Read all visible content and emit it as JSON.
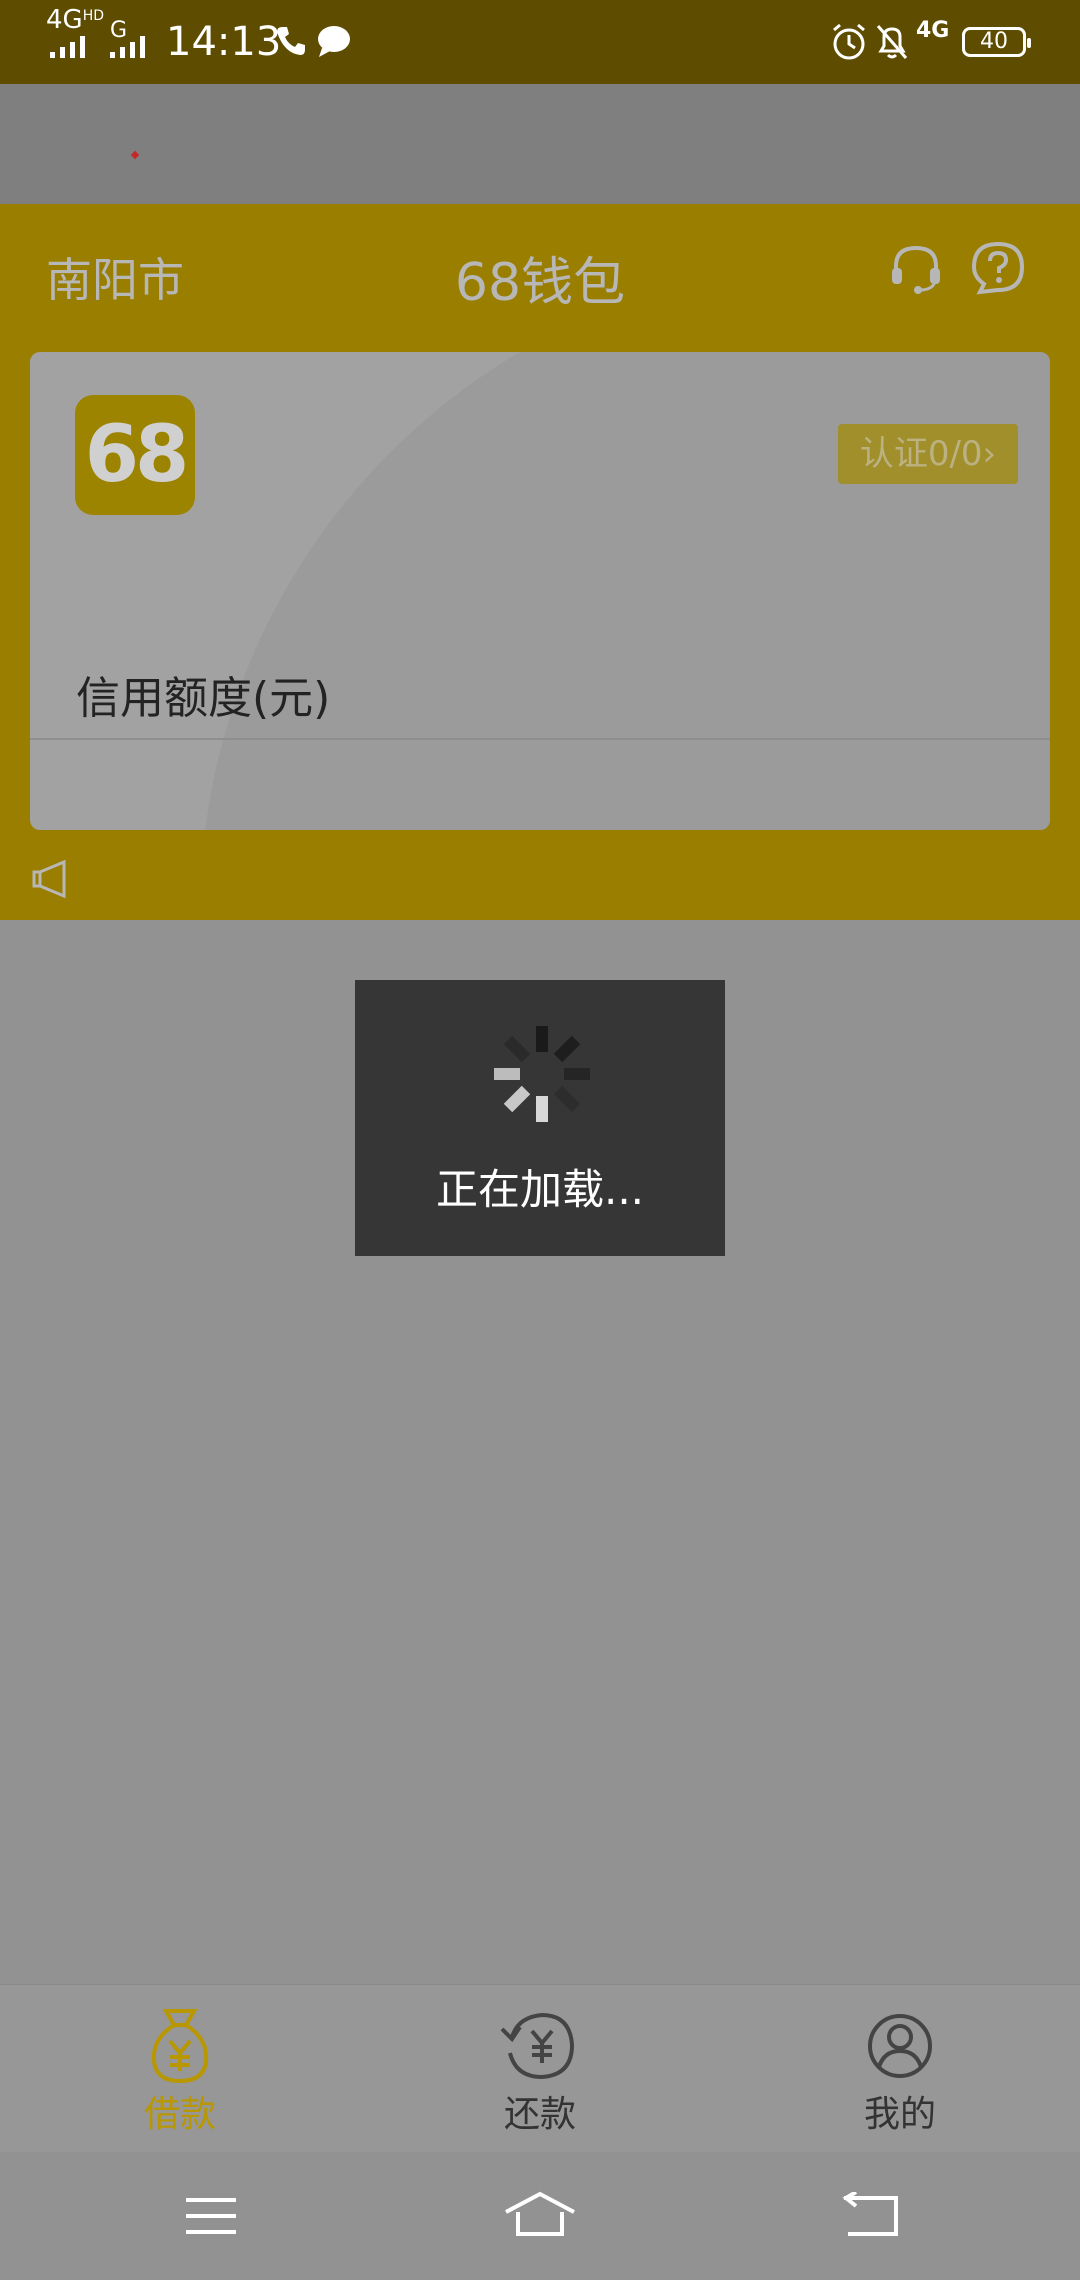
{
  "status_bar": {
    "network1": "4G",
    "network1_sup": "HD",
    "network2": "G",
    "time": "14:13",
    "network3": "4G",
    "battery": "40"
  },
  "header": {
    "city": "南阳市",
    "title": "68钱包"
  },
  "card": {
    "logo_text": "68",
    "cert_badge": "认证0/0",
    "credit_label": "信用额度(元)"
  },
  "loading": {
    "text": "正在加载..."
  },
  "bottom_nav": {
    "items": [
      {
        "label": "借款",
        "icon": "money-bag-icon",
        "active": true
      },
      {
        "label": "还款",
        "icon": "repay-icon",
        "active": false
      },
      {
        "label": "我的",
        "icon": "profile-icon",
        "active": false
      }
    ]
  },
  "colors": {
    "accent": "#9a7e00",
    "active_tab": "#b89700",
    "status_bar": "#5e4d00"
  }
}
